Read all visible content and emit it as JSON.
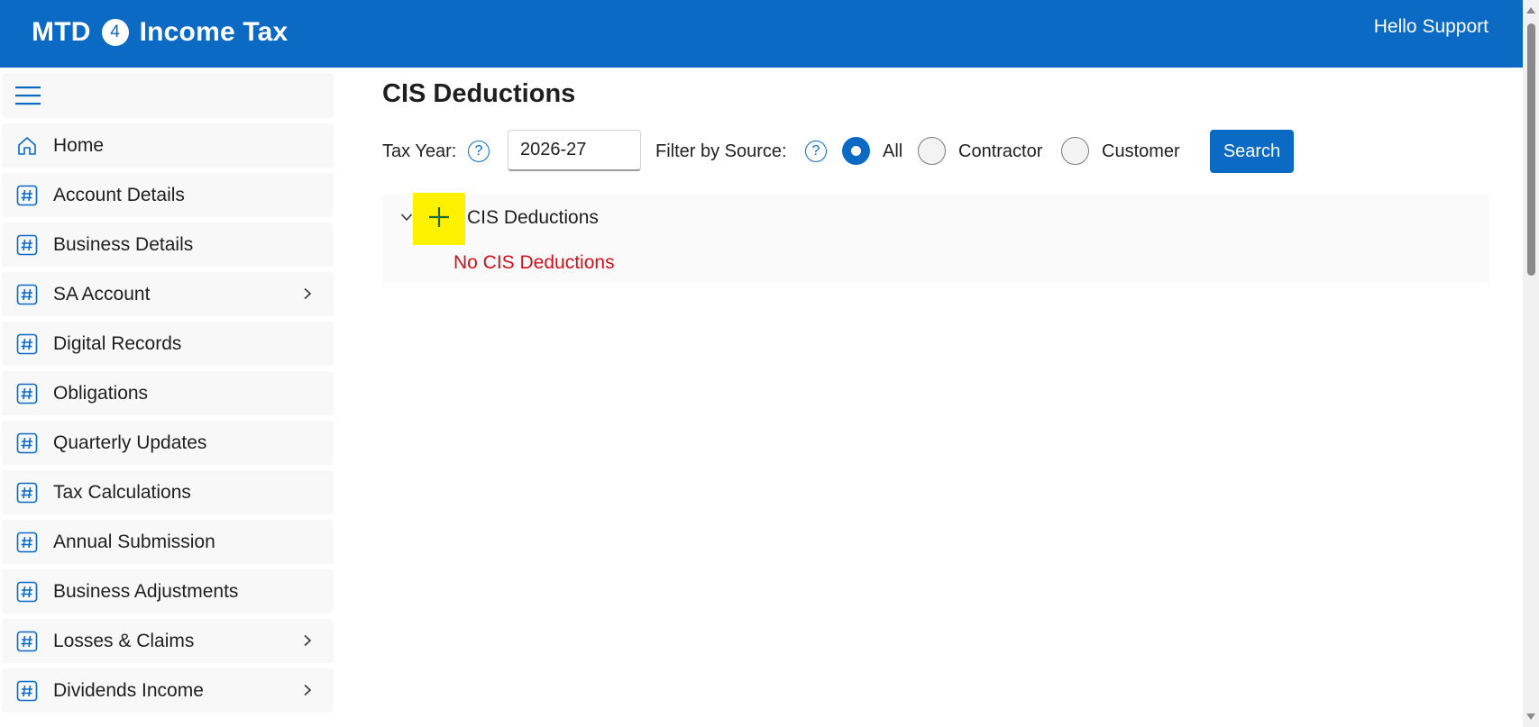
{
  "header": {
    "brand_prefix": "MTD",
    "brand_badge": "4",
    "brand_suffix": "Income Tax",
    "greeting": "Hello Support"
  },
  "sidebar": {
    "menu_icon": "hamburger-icon",
    "items": [
      {
        "label": "Home",
        "icon": "home-icon",
        "has_submenu": false
      },
      {
        "label": "Account Details",
        "icon": "hash-icon",
        "has_submenu": false
      },
      {
        "label": "Business Details",
        "icon": "hash-icon",
        "has_submenu": false
      },
      {
        "label": "SA Account",
        "icon": "hash-icon",
        "has_submenu": true
      },
      {
        "label": "Digital Records",
        "icon": "hash-icon",
        "has_submenu": false
      },
      {
        "label": "Obligations",
        "icon": "hash-icon",
        "has_submenu": false
      },
      {
        "label": "Quarterly Updates",
        "icon": "hash-icon",
        "has_submenu": false
      },
      {
        "label": "Tax Calculations",
        "icon": "hash-icon",
        "has_submenu": false
      },
      {
        "label": "Annual Submission",
        "icon": "hash-icon",
        "has_submenu": false
      },
      {
        "label": "Business Adjustments",
        "icon": "hash-icon",
        "has_submenu": false
      },
      {
        "label": "Losses & Claims",
        "icon": "hash-icon",
        "has_submenu": true
      },
      {
        "label": "Dividends Income",
        "icon": "hash-icon",
        "has_submenu": true
      }
    ]
  },
  "main": {
    "title": "CIS Deductions",
    "filters": {
      "tax_year_label": "Tax Year:",
      "tax_year_value": "2026-27",
      "source_label": "Filter by Source:",
      "help_glyph": "?",
      "options": [
        {
          "label": "All",
          "checked": true
        },
        {
          "label": "Contractor",
          "checked": false
        },
        {
          "label": "Customer",
          "checked": false
        }
      ],
      "search_label": "Search"
    },
    "panel": {
      "title": "CIS Deductions",
      "empty_message": "No CIS Deductions",
      "add_icon": "plus-icon",
      "expand_icon": "chevron-down-icon"
    }
  },
  "colors": {
    "brand_blue": "#0a6ac4",
    "highlight_yellow": "#fff200",
    "error_red": "#d0101b"
  }
}
